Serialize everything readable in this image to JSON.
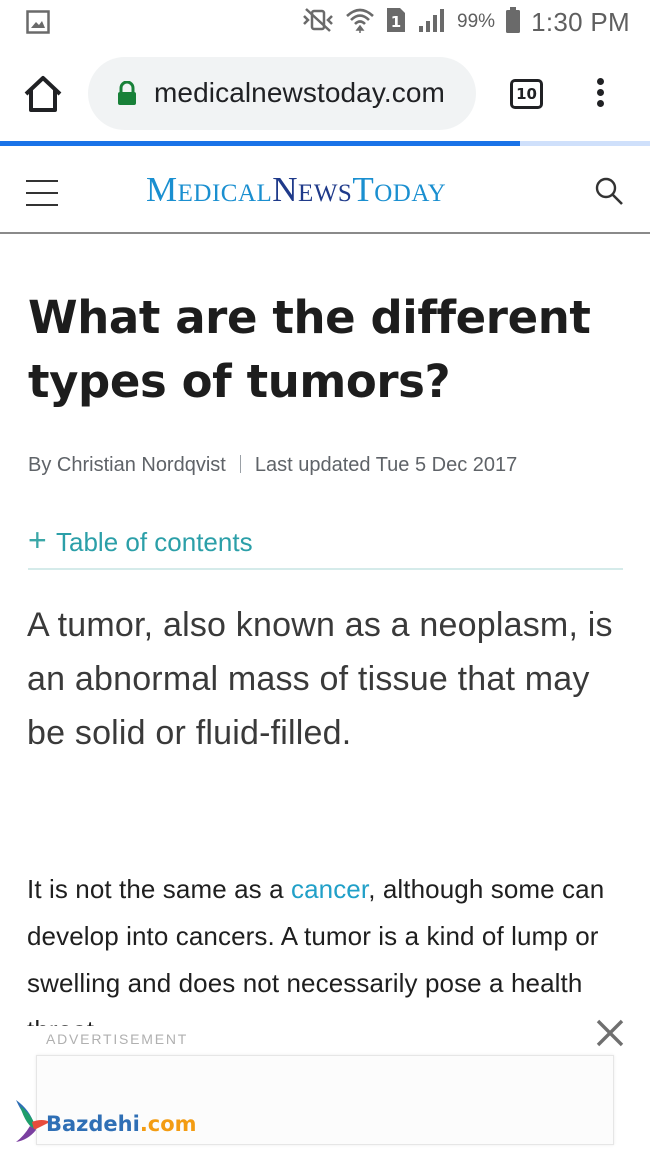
{
  "status_bar": {
    "battery": "99%",
    "time": "1:30 PM",
    "sim_slot": "1",
    "icons": [
      "gallery-notification-icon",
      "vibrate-mute-icon",
      "wifi-icon",
      "sim-icon",
      "signal-icon",
      "battery-icon"
    ]
  },
  "browser": {
    "url": "medicalnewstoday.com",
    "tab_count": "10",
    "page_load_progress": 0.8,
    "icons": [
      "home-icon",
      "lock-icon",
      "tabs-icon",
      "overflow-menu-icon"
    ]
  },
  "site_header": {
    "logo_part1": "Medical",
    "logo_part2": "News",
    "logo_part3": "Today",
    "icons": [
      "hamburger-menu-icon",
      "search-icon"
    ]
  },
  "article": {
    "title": "What are the different types of tumors?",
    "author": "By Christian Nordqvist",
    "updated": "Last updated Tue 5 Dec 2017",
    "toc_label": "Table of contents",
    "toc_icon": "plus-icon",
    "lede": "A tumor, also known as a neoplasm, is an abnormal mass of tissue that may be solid or fluid-filled.",
    "body_before_link": "It is not the same as a ",
    "body_link": "cancer",
    "body_after_link": ", although some can develop into cancers. A tumor is a kind of lump or swelling and does not necessarily pose a health threat."
  },
  "ad": {
    "label": "ADVERTISEMENT",
    "close_icon": "close-icon"
  },
  "watermark": {
    "text_part1": "Bazdehi",
    "text_part2": ".com"
  },
  "colors": {
    "browser_progress": "#1a73e8",
    "logo_teal": "#1a8fd0",
    "logo_navy": "#1f3a8a",
    "link": "#21a0c8",
    "toc": "#2b9fa8",
    "lock_green": "#188038"
  }
}
